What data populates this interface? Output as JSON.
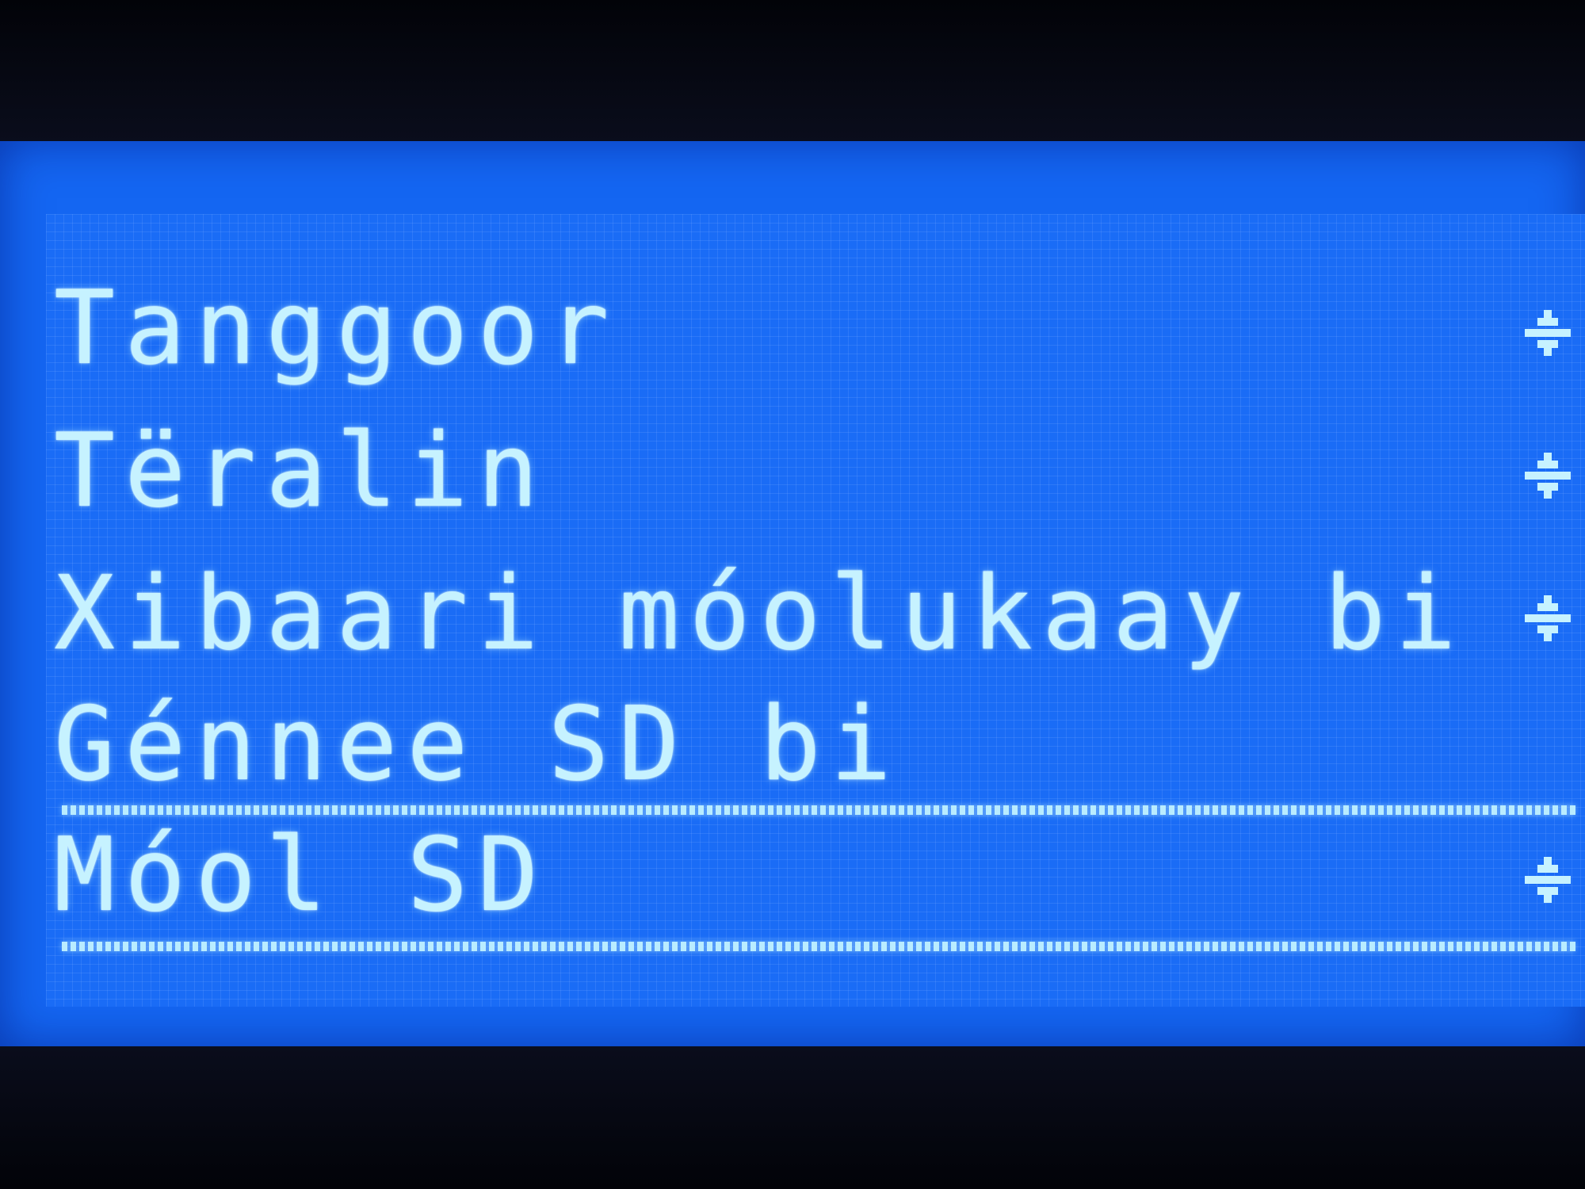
{
  "display": {
    "background_color": "#1466f2",
    "text_color": "#c6f2ff"
  },
  "menu": {
    "items": [
      {
        "label": "Tanggoor",
        "icon": "submenu-arrow-icon"
      },
      {
        "label": "Tëralin",
        "icon": "submenu-arrow-icon"
      },
      {
        "label": "Xibaari móolukaay bi",
        "icon": "submenu-arrow-icon"
      },
      {
        "label": "Génnee SD bi",
        "icon": ""
      },
      {
        "label": "Móol SD",
        "icon": "submenu-arrow-icon"
      }
    ],
    "selected_label": "Génnee SD bi"
  }
}
